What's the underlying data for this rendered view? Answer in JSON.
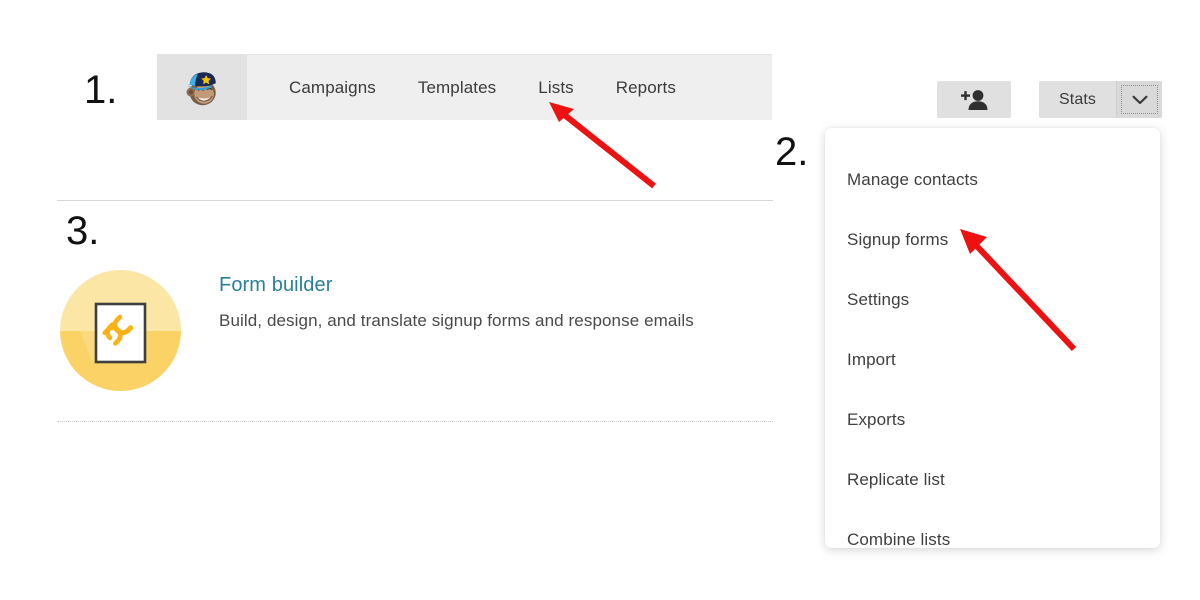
{
  "steps": [
    {
      "id": "1",
      "label": "1."
    },
    {
      "id": "2",
      "label": "2."
    },
    {
      "id": "3",
      "label": "3."
    }
  ],
  "navbar": {
    "logo": "mailchimp-freddie-logo",
    "links": [
      {
        "label": "Campaigns"
      },
      {
        "label": "Templates"
      },
      {
        "label": "Lists"
      },
      {
        "label": "Reports"
      }
    ]
  },
  "toolbar": {
    "add_person_icon": "add-person-icon",
    "stats_label": "Stats",
    "caret_icon": "chevron-down-icon"
  },
  "dropdown": {
    "items": [
      {
        "label": "Manage contacts"
      },
      {
        "label": "Signup forms"
      },
      {
        "label": "Settings"
      },
      {
        "label": "Import"
      },
      {
        "label": "Exports"
      },
      {
        "label": "Replicate list"
      },
      {
        "label": "Combine lists"
      }
    ]
  },
  "form_builder": {
    "icon": "document-link-icon",
    "title": "Form builder",
    "description": "Build, design, and translate signup forms and response emails"
  },
  "annotations": {
    "arrows": [
      {
        "name": "arrow-to-lists",
        "points_to": "Lists",
        "color": "#ee1111"
      },
      {
        "name": "arrow-to-signup-forms",
        "points_to": "Signup forms",
        "color": "#ee1111"
      }
    ]
  },
  "colors": {
    "nav_bg": "#efefef",
    "logo_tile_bg": "#e2e2e2",
    "button_bg": "#e0e0e0",
    "link_teal": "#2b7f9b",
    "icon_circle_light": "#fce6a6",
    "icon_circle_dark": "#fad265",
    "icon_link_orange": "#fcb116",
    "arrow_red": "#ee1111"
  }
}
